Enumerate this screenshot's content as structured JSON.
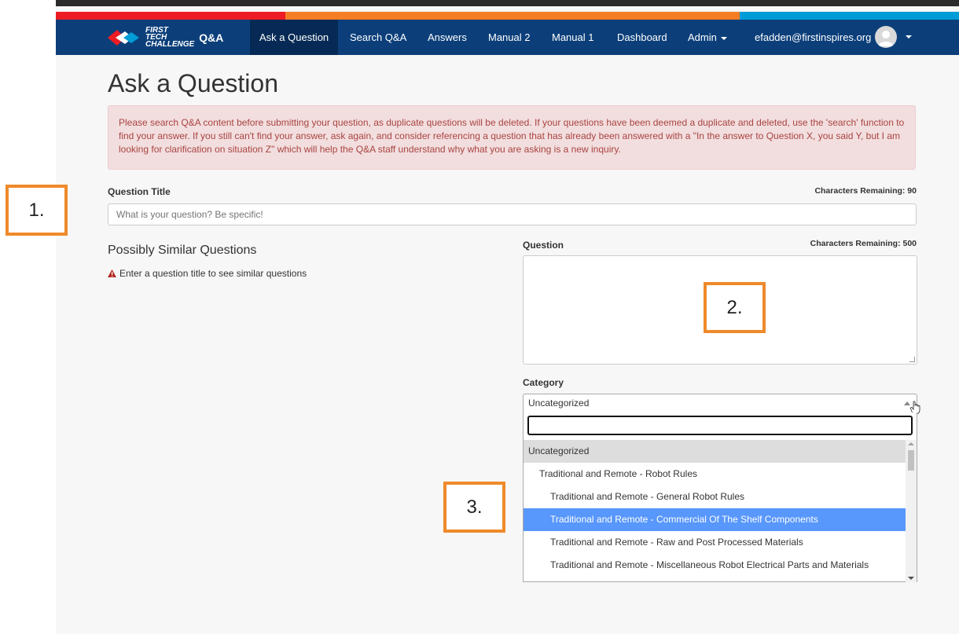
{
  "colors": {
    "nav_bg": "#0c3f7a",
    "nav_active": "#062a55",
    "stripe_red": "#ed1c24",
    "stripe_orange": "#f57e25",
    "stripe_blue": "#009cd7",
    "callout": "#ef8a2a",
    "highlight": "#5897fb"
  },
  "nav": {
    "brand_first": "FIRST",
    "brand_tech": "TECH",
    "brand_challenge": "CHALLENGE",
    "brand_qa": "Q&A",
    "items": [
      "Ask a Question",
      "Search Q&A",
      "Answers",
      "Manual 2",
      "Manual 1",
      "Dashboard"
    ],
    "admin": "Admin",
    "user_email": "efadden@firstinspires.org"
  },
  "page": {
    "title": "Ask a Question",
    "alert": "Please search Q&A content before submitting your question, as duplicate questions will be deleted. If your questions have been deemed a duplicate and deleted, use the 'search' function to find your answer. If you still can't find your answer, ask again, and consider referencing a question that has already been answered with a \"In the answer to Question X, you said Y, but I am looking for clarification on situation Z\" which will help the Q&A staff understand why what you are asking is a new inquiry."
  },
  "form": {
    "question_title_label": "Question Title",
    "title_remaining": "Characters Remaining: 90",
    "title_placeholder": "What is your question? Be specific!",
    "similar_heading": "Possibly Similar Questions",
    "similar_hint": "Enter a question title to see similar questions",
    "question_label": "Question",
    "question_remaining": "Characters Remaining: 500",
    "category_label": "Category",
    "category_selected": "Uncategorized",
    "category_options": [
      {
        "label": "Uncategorized",
        "level": 0,
        "state": "group"
      },
      {
        "label": "Traditional and Remote - Robot Rules",
        "level": 1,
        "state": "normal"
      },
      {
        "label": "Traditional and Remote - General Robot Rules",
        "level": 2,
        "state": "normal"
      },
      {
        "label": "Traditional and Remote - Commercial Of The Shelf Components",
        "level": 2,
        "state": "highlighted"
      },
      {
        "label": "Traditional and Remote - Raw and Post Processed Materials",
        "level": 2,
        "state": "normal"
      },
      {
        "label": "Traditional and Remote - Miscellaneous Robot Electrical Parts and Materials",
        "level": 2,
        "state": "normal"
      }
    ]
  },
  "callouts": [
    "1.",
    "2.",
    "3."
  ]
}
